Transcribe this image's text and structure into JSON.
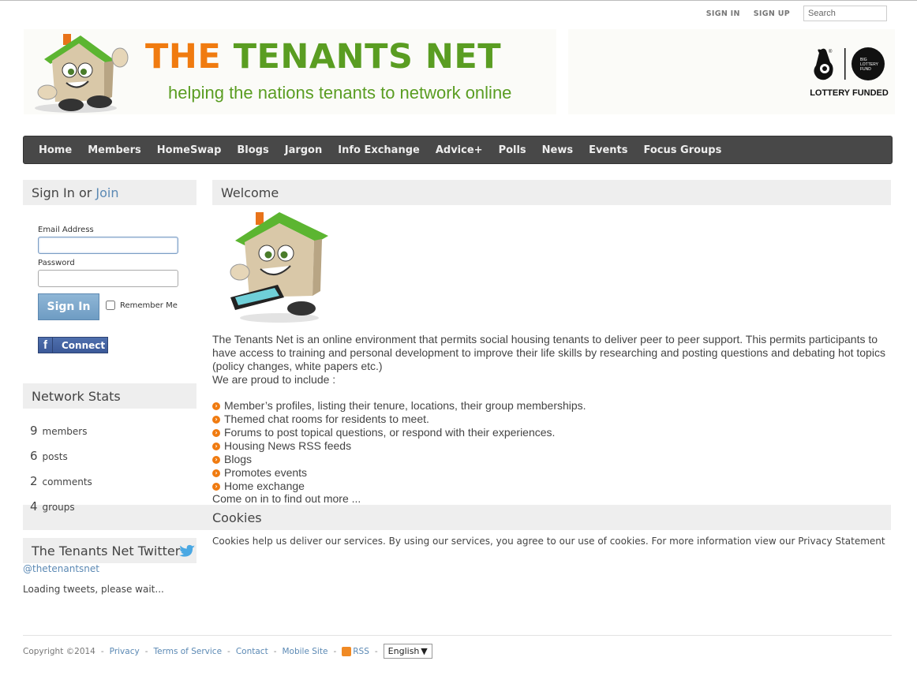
{
  "topbar": {
    "sign_in": "SIGN IN",
    "sign_up": "SIGN UP",
    "search_placeholder": "Search"
  },
  "banner": {
    "title_part1": "THE",
    "title_part2": "TENANTS NET",
    "tagline": "helping the nations tenants to network online",
    "lottery_label": "LOTTERY FUNDED",
    "colors": {
      "orange": "#f07b10",
      "green": "#5a9d22"
    }
  },
  "nav": {
    "items": [
      "Home",
      "Members",
      "HomeSwap",
      "Blogs",
      "Jargon",
      "Info Exchange",
      "Advice+",
      "Polls",
      "News",
      "Events",
      "Focus Groups"
    ]
  },
  "signin": {
    "heading": "Sign In",
    "heading_or": "or",
    "join_link": "Join",
    "email_label": "Email Address",
    "password_label": "Password",
    "button": "Sign In",
    "remember_label": "Remember Me",
    "facebook_button": "Connect"
  },
  "stats": {
    "heading": "Network Stats",
    "items": [
      {
        "num": "9",
        "label": "members"
      },
      {
        "num": "6",
        "label": "posts"
      },
      {
        "num": "2",
        "label": "comments"
      },
      {
        "num": "4",
        "label": "groups"
      }
    ]
  },
  "twitter": {
    "heading": "The Tenants Net Twitter",
    "handle": "@thetenantsnet",
    "loading": "Loading tweets, please wait..."
  },
  "welcome": {
    "heading": "Welcome",
    "intro": "The Tenants Net is an online environment that permits social housing tenants to deliver peer to peer support. This permits participants to have access to training and personal development to improve their life skills by researching and posting questions and debating hot topics (policy changes, white papers etc.)",
    "proud": "We are proud to include :",
    "bullets": [
      "Member’s profiles, listing their tenure, locations, their group memberships.",
      "Themed chat rooms for residents to meet.",
      "Forums to post topical questions, or respond with their experiences.",
      "Housing News RSS feeds",
      "Blogs",
      "Promotes events",
      "Home exchange"
    ],
    "closing": "Come on in to find out more ..."
  },
  "cookies": {
    "heading": "Cookies",
    "text": "Cookies help us deliver our services. By using our services, you agree to our use of cookies. For more information view our Privacy Statement"
  },
  "footer": {
    "copyright": "Copyright ©2014",
    "links": [
      "Privacy",
      "Terms of Service",
      "Contact",
      "Mobile Site"
    ],
    "rss": "RSS",
    "language": "English"
  }
}
